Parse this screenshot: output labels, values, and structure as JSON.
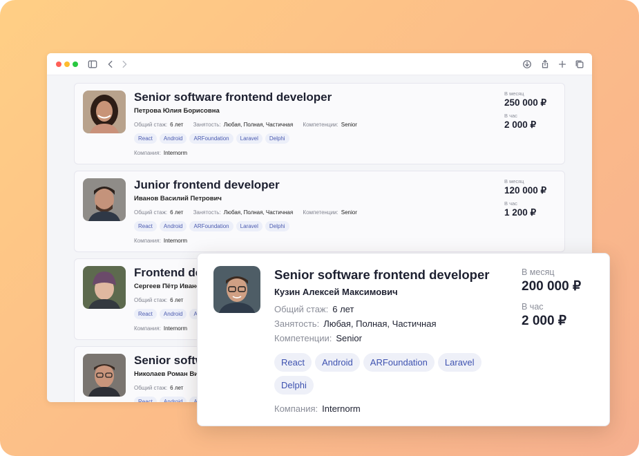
{
  "browser": {
    "traffic_lights": [
      "#ff5f57",
      "#febc2e",
      "#28c840"
    ],
    "icons": [
      "sidebar-icon",
      "back-icon",
      "forward-icon",
      "download-icon",
      "share-icon",
      "new-tab-icon",
      "tabs-overview-icon"
    ]
  },
  "labels": {
    "experience": "Общий стаж:",
    "employment": "Занятость:",
    "competence": "Компетенции:",
    "company": "Компания:",
    "per_month": "В месяц",
    "per_hour": "В час"
  },
  "cards": [
    {
      "title": "Senior software frontend developer",
      "name": "Петрова Юлия Борисовна",
      "experience": "6 лет",
      "employment": "Любая, Полная, Частичная",
      "competence": "Senior",
      "tags": [
        "React",
        "Android",
        "ARFoundation",
        "Laravel",
        "Delphi"
      ],
      "company": "Internorm",
      "salary_month": "250 000 ₽",
      "salary_hour": "2 000 ₽"
    },
    {
      "title": "Junior frontend developer",
      "name": "Иванов Василий Петрович",
      "experience": "6 лет",
      "employment": "Любая, Полная, Частичная",
      "competence": "Senior",
      "tags": [
        "React",
        "Android",
        "ARFoundation",
        "Laravel",
        "Delphi"
      ],
      "company": "Internorm",
      "salary_month": "120 000 ₽",
      "salary_hour": "1 200 ₽"
    },
    {
      "title": "Frontend de",
      "name": "Сергеев Пётр Иванов",
      "experience": "6 лет",
      "employment": "",
      "competence": "",
      "tags": [
        "React",
        "Android",
        "AF"
      ],
      "company": "Internorm",
      "salary_month": "",
      "salary_hour": ""
    },
    {
      "title": "Senior softw",
      "name": "Николаев Роман Викт",
      "experience": "6 лет",
      "employment": "",
      "competence": "",
      "tags": [
        "React",
        "Android",
        "AF"
      ],
      "company": "",
      "salary_month": "",
      "salary_hour": ""
    }
  ],
  "popup": {
    "title": "Senior software frontend developer",
    "name": "Кузин Алексей Максимович",
    "experience": "6 лет",
    "employment": "Любая, Полная, Частичная",
    "competence": "Senior",
    "tags": [
      "React",
      "Android",
      "ARFoundation",
      "Laravel",
      "Delphi"
    ],
    "company": "Internorm",
    "salary_month": "200 000 ₽",
    "salary_hour": "2 000 ₽"
  }
}
